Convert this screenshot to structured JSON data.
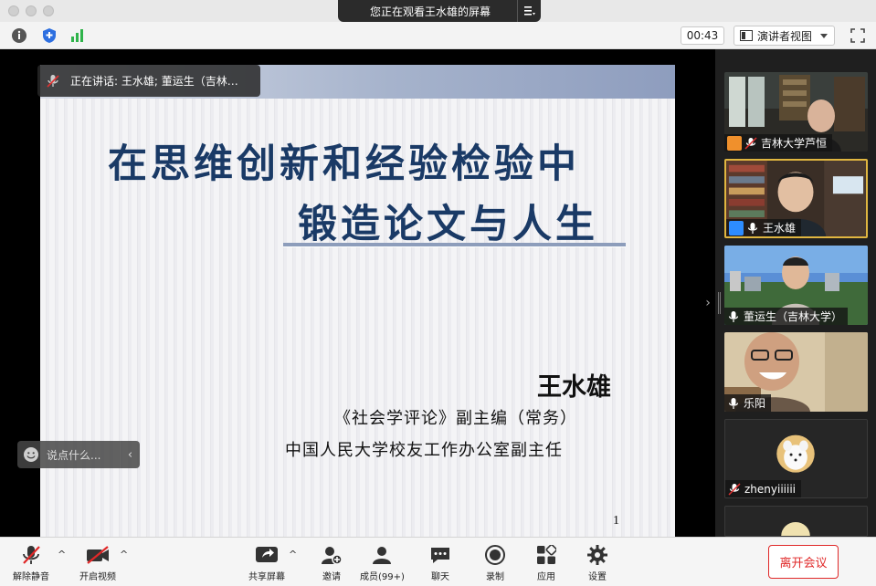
{
  "window": {
    "share_banner": "您正在观看王水雄的屏幕"
  },
  "toolbar": {
    "timer": "00:43",
    "view_mode": "演讲者视图"
  },
  "speaking": {
    "text": "正在讲话: 王水雄; 董运生（吉林…"
  },
  "slide": {
    "title_line1": "在思维创新和经验检验中",
    "title_line2": "锻造论文与人生",
    "author": "王水雄",
    "subtitle1": "《社会学评论》副主编（常务）",
    "subtitle2": "中国人民大学校友工作办公室副主任",
    "page": "1"
  },
  "chat": {
    "placeholder": "说点什么..."
  },
  "participants": [
    {
      "name": "吉林大学芦恒"
    },
    {
      "name": "王水雄"
    },
    {
      "name": "董运生（吉林大学）"
    },
    {
      "name": "乐阳"
    },
    {
      "name": "zhenyiiiiii"
    }
  ],
  "controls": {
    "mute": "解除静音",
    "video": "开启视频",
    "share": "共享屏幕",
    "invite": "邀请",
    "members": "成员(99+)",
    "chat": "聊天",
    "record": "录制",
    "apps": "应用",
    "settings": "设置",
    "leave": "离开会议"
  },
  "colors": {
    "slide_title": "#1a3a66",
    "leave": "#e02828",
    "host_badge": "#f0902c",
    "cohost_badge": "#2d8cff"
  }
}
